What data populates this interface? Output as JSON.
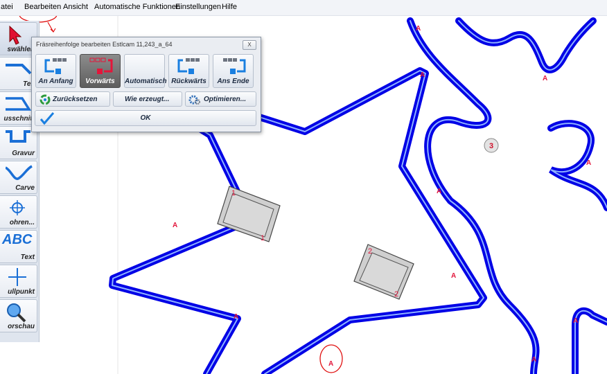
{
  "menu": {
    "items": [
      "atei",
      "Bearbeiten",
      "Ansicht",
      "Automatische Funktionen",
      "Einstellungen",
      "Hilfe"
    ]
  },
  "toolbar": {
    "tools": [
      {
        "label": "swählen",
        "icon": "cursor-arrow-icon"
      },
      {
        "label": "Teil",
        "icon": "part-outline-icon"
      },
      {
        "label": "usschnitt",
        "icon": "cutout-icon"
      },
      {
        "label": "Gravur",
        "icon": "engrave-icon"
      },
      {
        "label": "Carve",
        "icon": "carve-icon"
      },
      {
        "label": "ohren...",
        "icon": "drill-target-icon"
      },
      {
        "label": "Text",
        "icon": "abc-text-icon",
        "glyph": "ABC"
      },
      {
        "label": "ullpunkt",
        "icon": "zero-point-icon"
      },
      {
        "label": "orschau",
        "icon": "magnifier-icon"
      }
    ]
  },
  "dialog": {
    "title": "Fräsreihenfolge bearbeiten Estlcam 11,243_a_64",
    "close_label": "X",
    "order_buttons": [
      {
        "label": "An Anfang",
        "icon": "to-start-icon",
        "selected": false
      },
      {
        "label": "Vorwärts",
        "icon": "forward-icon",
        "selected": true
      },
      {
        "label": "Automatisch",
        "icon": "",
        "selected": false
      },
      {
        "label": "Rückwärts",
        "icon": "backward-icon",
        "selected": false
      },
      {
        "label": "Ans Ende",
        "icon": "to-end-icon",
        "selected": false
      }
    ],
    "reset_label": "Zurücksetzen",
    "how_label": "Wie erzeugt...",
    "optimize_label": "Optimieren...",
    "ok_label": "OK"
  },
  "canvas": {
    "path_marker": "A",
    "pocket_labels": [
      "1",
      "1",
      "2",
      "2"
    ],
    "part_number": "3"
  },
  "colors": {
    "path_blue": "#0000e6",
    "path_center": "#8fb3ff",
    "marker_red": "#e2163c",
    "annotation_red": "#e01010",
    "selected_dark": "#5e5e5e"
  }
}
